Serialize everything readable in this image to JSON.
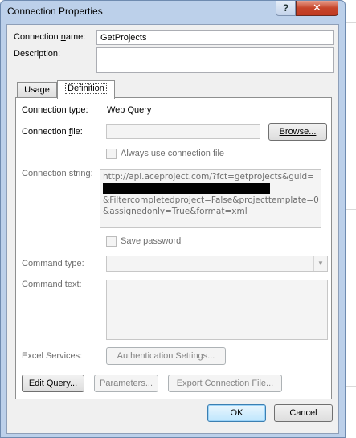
{
  "window": {
    "title": "Connection Properties",
    "help_label": "?",
    "close_label": "✕"
  },
  "connection_name": {
    "label": "Connection name:",
    "value": "GetProjects"
  },
  "description": {
    "label": "Description:",
    "value": ""
  },
  "tabs": [
    {
      "label": "Usage",
      "active": false
    },
    {
      "label": "Definition",
      "active": true
    }
  ],
  "definition": {
    "connection_type_label": "Connection type:",
    "connection_type_value": "Web Query",
    "connection_file_label": "Connection file:",
    "connection_file_value": "",
    "browse_label": "Browse...",
    "always_use_label": "Always use connection file",
    "connection_string_label": "Connection string:",
    "connection_string_lines": [
      "http://api.aceproject.com/?fct=getprojects&guid=",
      "&Filtercompletedproject=False&projecttemplate=0",
      "&assignedonly=True&format=xml"
    ],
    "save_password_label": "Save password",
    "command_type_label": "Command type:",
    "command_type_value": "",
    "command_text_label": "Command text:",
    "command_text_value": "",
    "excel_services_label": "Excel Services:",
    "auth_settings_label": "Authentication Settings...",
    "edit_query_label": "Edit Query...",
    "parameters_label": "Parameters...",
    "export_label": "Export Connection File..."
  },
  "footer": {
    "ok_label": "OK",
    "cancel_label": "Cancel"
  }
}
